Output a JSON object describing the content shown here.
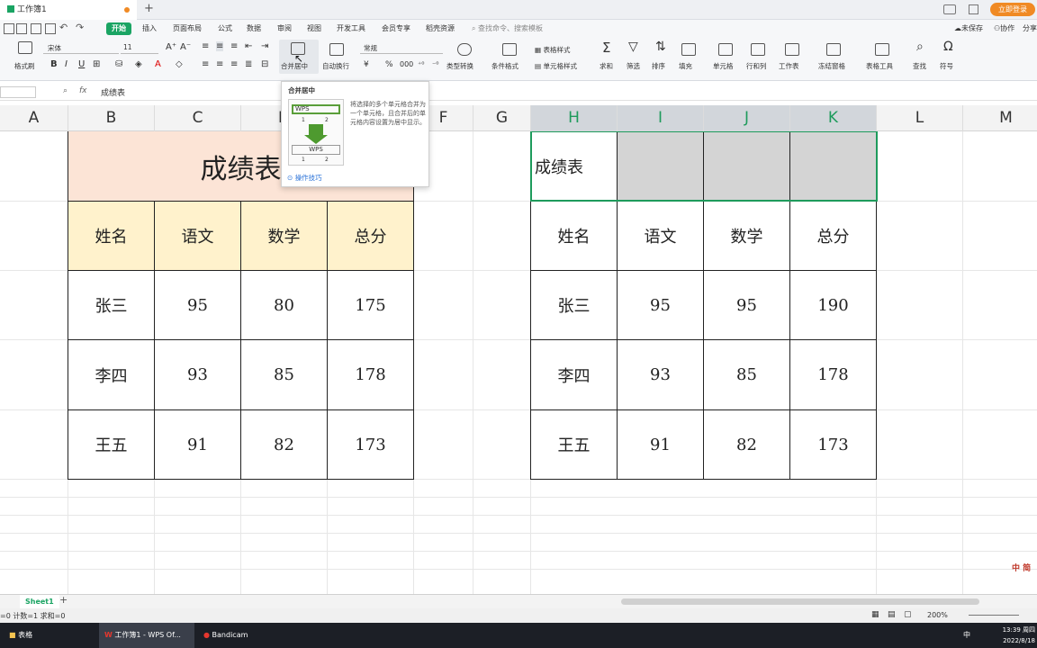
{
  "titlebar": {
    "doc_tab": "工作簿1",
    "add_tab": "+",
    "login_button": "立即登录"
  },
  "menubar": {
    "items": [
      "开始",
      "插入",
      "页面布局",
      "公式",
      "数据",
      "审阅",
      "视图",
      "开发工具",
      "会员专享",
      "稻壳资源"
    ],
    "search_placeholder": "查找命令、搜索模板",
    "unsaved": "未保存",
    "collab": "协作",
    "share": "分享"
  },
  "ribbon": {
    "format_painter": "格式刷",
    "font_name": "宋体",
    "font_size": "11",
    "bold": "B",
    "italic": "I",
    "underline": "U",
    "merge_center": "合并居中",
    "wrap_text": "自动换行",
    "number_format": "常规",
    "currency": "¥",
    "percent": "%",
    "type_convert": "类型转换",
    "conditional_format": "条件格式",
    "table_style": "表格样式",
    "cell_style": "单元格样式",
    "sum": "求和",
    "filter": "筛选",
    "sort": "排序",
    "fill": "填充",
    "cell": "单元格",
    "row_col": "行和列",
    "worksheet": "工作表",
    "freeze": "冻结窗格",
    "table_tools": "表格工具",
    "find": "查找",
    "symbol": "符号"
  },
  "tooltip": {
    "title": "合并居中",
    "desc": "将选择的多个单元格合并为一个单元格，且合并后的单元格内容设置为居中显示。",
    "before_label": "WPS",
    "after_label": "WPS",
    "n1": "1",
    "n2": "2",
    "n3": "1",
    "n4": "2",
    "tip_link": "操作技巧"
  },
  "formula_bar": {
    "fx": "fx",
    "content": "成绩表"
  },
  "columns": [
    "A",
    "B",
    "C",
    "D",
    "E",
    "F",
    "G",
    "H",
    "I",
    "J",
    "K",
    "L",
    "M"
  ],
  "table_left": {
    "title": "成绩表",
    "headers": [
      "姓名",
      "语文",
      "数学",
      "总分"
    ],
    "rows": [
      [
        "张三",
        "95",
        "80",
        "175"
      ],
      [
        "李四",
        "93",
        "85",
        "178"
      ],
      [
        "王五",
        "91",
        "82",
        "173"
      ]
    ],
    "title_color": "#fce4d6",
    "header_color": "#fff2cc"
  },
  "table_right": {
    "title": "成绩表",
    "headers": [
      "姓名",
      "语文",
      "数学",
      "总分"
    ],
    "rows": [
      [
        "张三",
        "95",
        "95",
        "190"
      ],
      [
        "李四",
        "93",
        "85",
        "178"
      ],
      [
        "王五",
        "91",
        "82",
        "173"
      ]
    ],
    "selected_fill": "#d4d4d4",
    "selection_border": "#1e9b5c"
  },
  "sheet_tabs": {
    "active": "Sheet1",
    "add": "+"
  },
  "statusbar": {
    "stats": "=0  计数=1  求和=0",
    "zoom": "200%"
  },
  "taskbar": {
    "item1": "表格",
    "item2": "工作簿1 - WPS Of...",
    "item3": "Bandicam",
    "time": "13:39 周四",
    "date": "2022/8/18",
    "ime": "中"
  }
}
